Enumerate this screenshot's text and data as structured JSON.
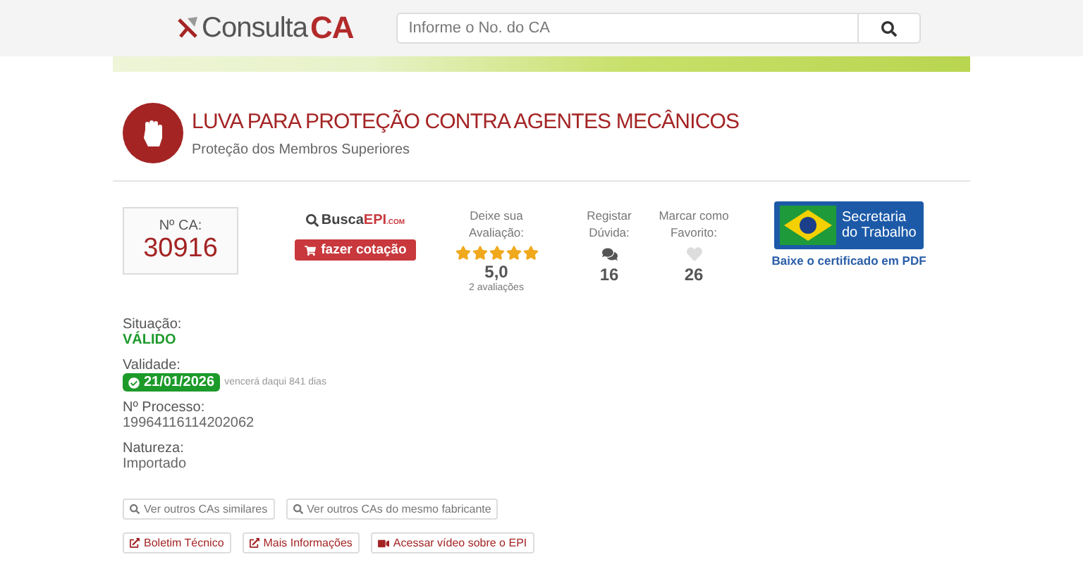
{
  "header": {
    "logo": {
      "light": "Consulta",
      "bold": "CA"
    },
    "search": {
      "placeholder": "Informe o No. do CA"
    }
  },
  "product": {
    "title": "LUVA PARA PROTEÇÃO CONTRA AGENTES MECÂNICOS",
    "category": "Proteção dos Membros Superiores"
  },
  "ca_card": {
    "label": "Nº CA:",
    "number": "30916"
  },
  "partner": {
    "logo_main": "Busca",
    "logo_accent": "EPI",
    "logo_suffix": ".COM",
    "button": "fazer cotação"
  },
  "rating": {
    "label": "Deixe sua Avaliação:",
    "stars": 5,
    "score": "5,0",
    "count": "2 avaliações"
  },
  "doubts": {
    "label": "Registar Dúvida:",
    "count": "16"
  },
  "favorite": {
    "label": "Marcar como Favorito:",
    "count": "26"
  },
  "ministry": {
    "line1": "Secretaria",
    "line2": "do Trabalho",
    "link": "Baixe o certificado em PDF"
  },
  "details": [
    {
      "kind": "status",
      "label": "Situação:",
      "value": "VÁLIDO"
    },
    {
      "kind": "badge",
      "label": "Validade:",
      "value": "21/01/2026",
      "note": "vencerá daqui 841 dias"
    },
    {
      "kind": "plain",
      "label": "Nº Processo:",
      "value": "19964116114202062"
    },
    {
      "kind": "plain",
      "label": "Natureza:",
      "value": "Importado"
    }
  ],
  "search_links": [
    "Ver outros CAs similares",
    "Ver outros CAs do mesmo fabricante"
  ],
  "action_links": [
    {
      "kind": "external",
      "label": "Boletim Técnico"
    },
    {
      "kind": "external",
      "label": "Mais Informações"
    },
    {
      "kind": "video",
      "label": "Acessar vídeo sobre o EPI"
    }
  ]
}
